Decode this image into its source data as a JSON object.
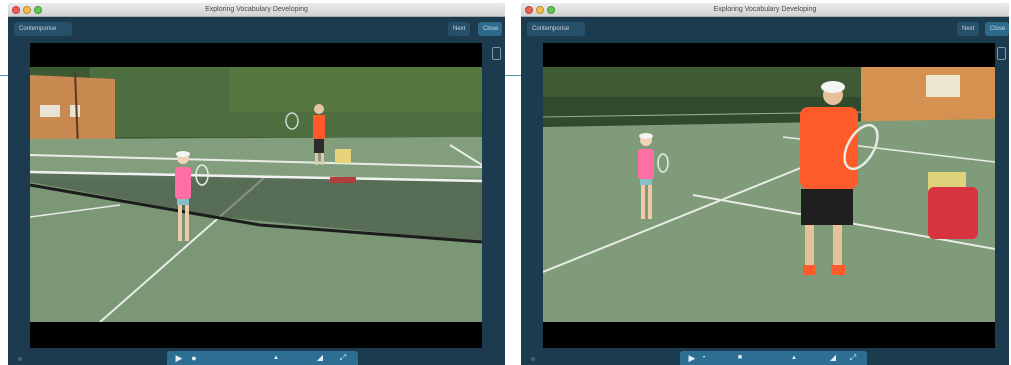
{
  "window_title": "Exploring Vocabulary Developing",
  "left_window": {
    "toolbar": {
      "left_button": "Contemporise",
      "button_a": "Next",
      "button_b": "Close"
    },
    "controls": [
      "play-icon",
      "record-icon",
      "chevron-up-icon",
      "volume-icon",
      "fullscreen-icon"
    ]
  },
  "right_window": {
    "toolbar": {
      "left_button": "Contemporise",
      "button_a": "Next",
      "button_b": "Close"
    },
    "controls": [
      "play-icon",
      "stop-icon",
      "chevron-up-icon",
      "volume-icon",
      "fullscreen-icon"
    ]
  },
  "colors": {
    "panel": "#1c3b4f",
    "court": "#6f8c6a",
    "control_bar": "#2c6f93",
    "coach_shirt": "#ff5a2a",
    "girl_shirt": "#ff6fa5"
  }
}
